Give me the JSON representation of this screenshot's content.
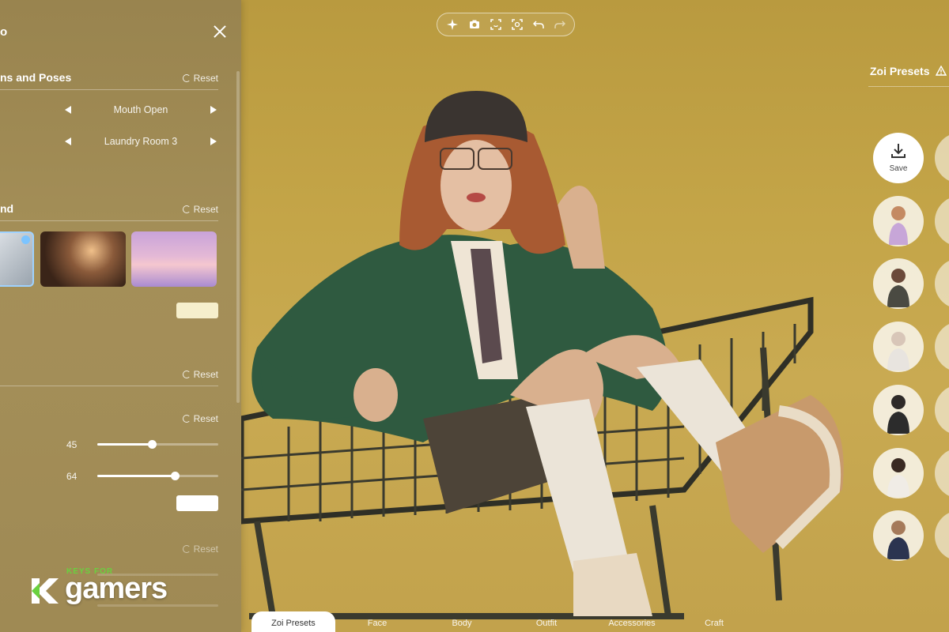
{
  "left_panel": {
    "title": "o",
    "sections": [
      {
        "title": "ns and Poses",
        "reset_label": "Reset"
      },
      {
        "title": "nd",
        "reset_label": "Reset"
      },
      {
        "title": "",
        "reset_label": "Reset"
      },
      {
        "title": "",
        "reset_label": "Reset"
      },
      {
        "title": "",
        "reset_label": "Reset"
      }
    ],
    "selectors": [
      {
        "value": "Mouth Open"
      },
      {
        "value": "Laundry Room 3"
      }
    ],
    "background_thumbnails": [
      "studio-gray",
      "room-night",
      "pink-clouds"
    ],
    "swatch_colors": [
      "#f6efcc",
      "#ffffff"
    ],
    "sliders": [
      {
        "value": "45",
        "fraction": 0.45
      },
      {
        "value": "64",
        "fraction": 0.64
      }
    ]
  },
  "watermark": {
    "small_text": "KEYS FOR",
    "big_text": "gamers"
  },
  "toolbar": {
    "icons": [
      "sparkle-icon",
      "camera-icon",
      "face-scan-icon",
      "focus-icon",
      "undo-icon",
      "redo-icon"
    ]
  },
  "presets": {
    "title": "Zoi Presets",
    "save_label": "Save",
    "avatars": [
      "preset-1",
      "preset-2",
      "preset-3",
      "preset-4",
      "preset-5",
      "preset-6"
    ]
  },
  "tabs": [
    {
      "label": "Zoi Presets",
      "active": true
    },
    {
      "label": "Face",
      "active": false
    },
    {
      "label": "Body",
      "active": false
    },
    {
      "label": "Outfit",
      "active": false
    },
    {
      "label": "Accessories",
      "active": false
    },
    {
      "label": "Craft",
      "active": false
    }
  ],
  "colors": {
    "accent_check": "#7cc4ff",
    "watermark_green": "#6ad13f",
    "background": "#c4a548"
  }
}
